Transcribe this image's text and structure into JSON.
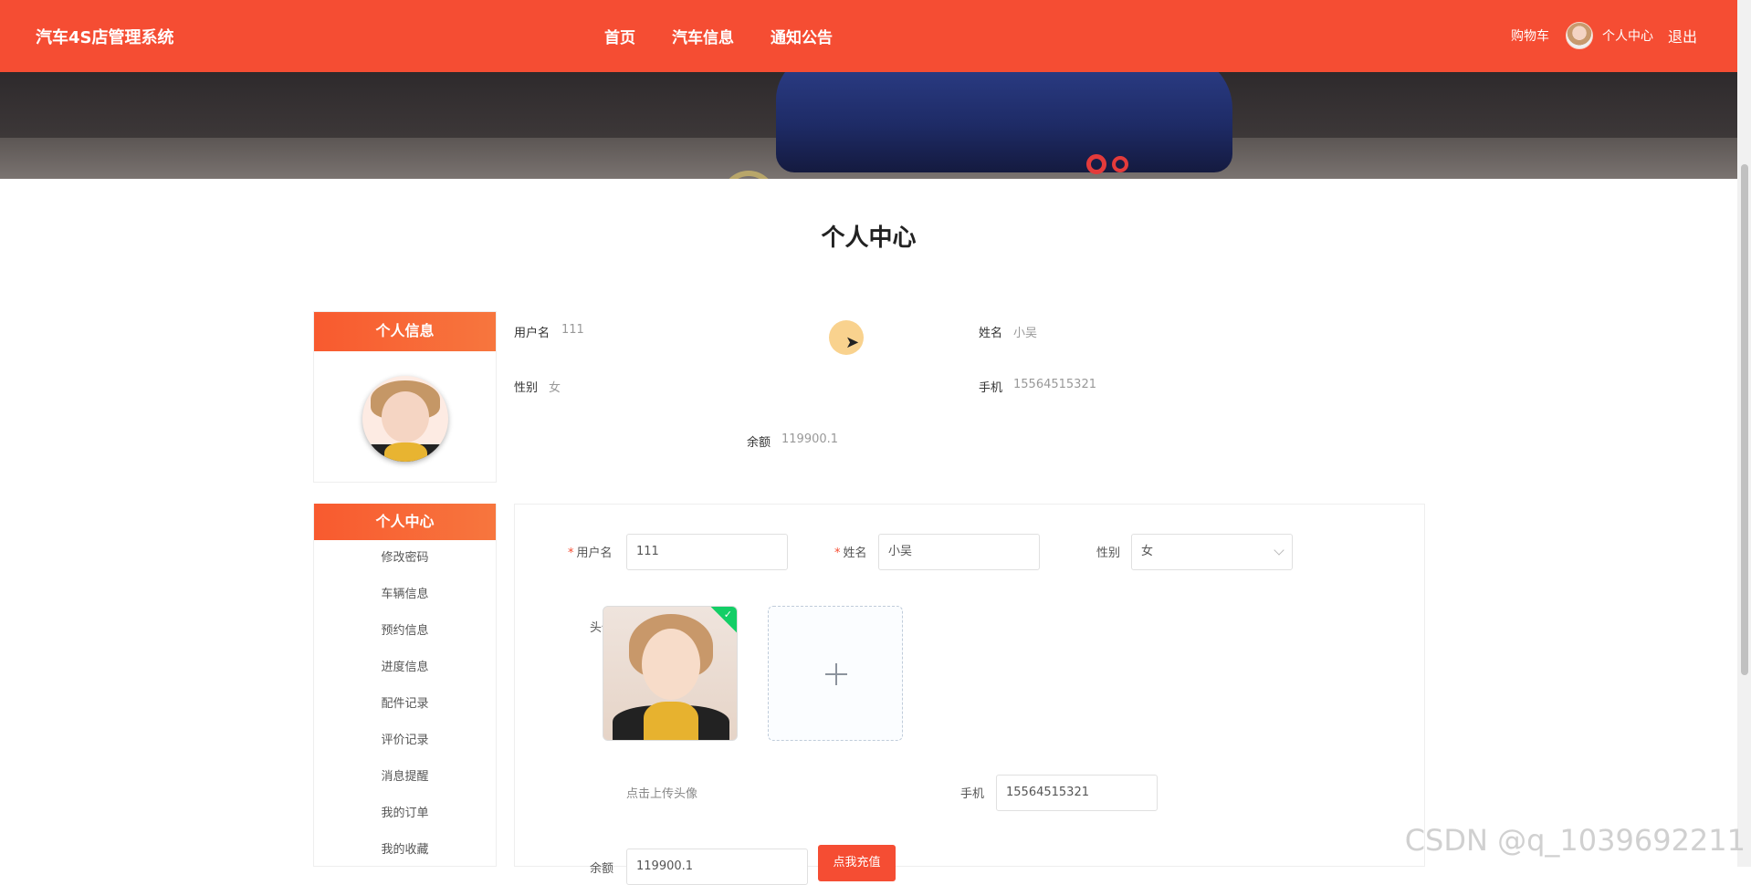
{
  "nav": {
    "brand": "汽车4S店管理系统",
    "links": [
      "首页",
      "汽车信息",
      "通知公告"
    ],
    "cart": "购物车",
    "center": "个人中心",
    "logout": "退出"
  },
  "page": {
    "title": "个人中心"
  },
  "profile_panel": {
    "header": "个人信息"
  },
  "menu": {
    "header": "个人中心",
    "items": [
      "修改密码",
      "车辆信息",
      "预约信息",
      "进度信息",
      "配件记录",
      "评价记录",
      "消息提醒",
      "我的订单",
      "我的收藏"
    ]
  },
  "info": {
    "username_label": "用户名",
    "username": "111",
    "name_label": "姓名",
    "name": "小吴",
    "gender_label": "性别",
    "gender": "女",
    "phone_label": "手机",
    "phone": "15564515321",
    "balance_label": "余额",
    "balance": "119900.1"
  },
  "form": {
    "username_label": "用户名",
    "username_value": "111",
    "name_label": "姓名",
    "name_value": "小吴",
    "gender_label": "性别",
    "gender_value": "女",
    "avatar_label": "头像",
    "upload_hint": "点击上传头像",
    "phone_label": "手机",
    "phone_value": "15564515321",
    "balance_label": "余额",
    "balance_value": "119900.1",
    "recharge_button": "点我充值",
    "required_mark": "*"
  },
  "watermark": "CSDN @q_1039692211",
  "colors": {
    "primary": "#f54d33",
    "success": "#13ce66"
  }
}
